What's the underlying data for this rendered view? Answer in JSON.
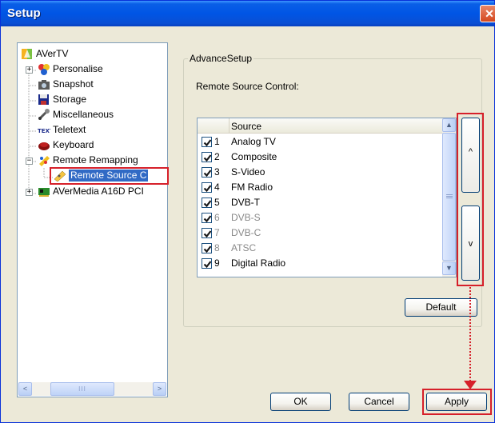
{
  "window": {
    "title": "Setup",
    "close_glyph": "✕"
  },
  "tree": {
    "items": [
      {
        "label": "AVerTV",
        "icon": "avertv-icon"
      },
      {
        "label": "Personalise",
        "icon": "personalise-icon"
      },
      {
        "label": "Snapshot",
        "icon": "snapshot-icon"
      },
      {
        "label": "Storage",
        "icon": "storage-icon"
      },
      {
        "label": "Miscellaneous",
        "icon": "miscellaneous-icon"
      },
      {
        "label": "Teletext",
        "icon": "teletext-icon"
      },
      {
        "label": "Keyboard",
        "icon": "keyboard-icon"
      },
      {
        "label": "Remote Remapping",
        "icon": "remote-remapping-icon"
      },
      {
        "label": "Remote Source C",
        "icon": "remote-source-icon",
        "selected": true
      },
      {
        "label": "AVerMedia A16D PCI",
        "icon": "device-card-icon"
      }
    ],
    "teletext_icon_text": "TEXT",
    "scroll_left": "<",
    "scroll_right": ">",
    "scroll_grip": "III"
  },
  "advance_setup": {
    "group_label": "AdvanceSetup",
    "remote_source_label": "Remote Source Control:",
    "list": {
      "column_header": "Source",
      "rows": [
        {
          "num": "1",
          "source": "Analog TV",
          "checked": true,
          "enabled": true
        },
        {
          "num": "2",
          "source": "Composite",
          "checked": true,
          "enabled": true
        },
        {
          "num": "3",
          "source": "S-Video",
          "checked": true,
          "enabled": true
        },
        {
          "num": "4",
          "source": "FM Radio",
          "checked": true,
          "enabled": true
        },
        {
          "num": "5",
          "source": "DVB-T",
          "checked": true,
          "enabled": true
        },
        {
          "num": "6",
          "source": "DVB-S",
          "checked": true,
          "enabled": false
        },
        {
          "num": "7",
          "source": "DVB-C",
          "checked": true,
          "enabled": false
        },
        {
          "num": "8",
          "source": "ATSC",
          "checked": true,
          "enabled": false
        },
        {
          "num": "9",
          "source": "Digital Radio",
          "checked": true,
          "enabled": true
        }
      ],
      "scroll_up": "▲",
      "scroll_down": "▼"
    },
    "move_up_label": "^",
    "move_down_label": "v",
    "default_label": "Default"
  },
  "footer": {
    "ok_label": "OK",
    "cancel_label": "Cancel",
    "apply_label": "Apply"
  },
  "colors": {
    "highlight": "#d6202a",
    "selection": "#316ac5",
    "titlebar": "#0055e5"
  }
}
